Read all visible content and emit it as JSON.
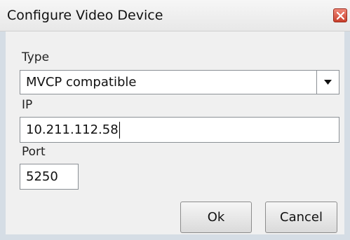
{
  "window": {
    "title": "Configure Video Device"
  },
  "form": {
    "type_label": "Type",
    "type_value": "MVCP compatible",
    "ip_label": "IP",
    "ip_value": "10.211.112.58",
    "port_label": "Port",
    "port_value": "5250"
  },
  "buttons": {
    "ok_label": "Ok",
    "cancel_label": "Cancel"
  },
  "icons": {
    "close": "close-icon",
    "dropdown": "chevron-down-icon"
  },
  "colors": {
    "close_button": "#c9402c",
    "frame": "#d5dde5"
  }
}
